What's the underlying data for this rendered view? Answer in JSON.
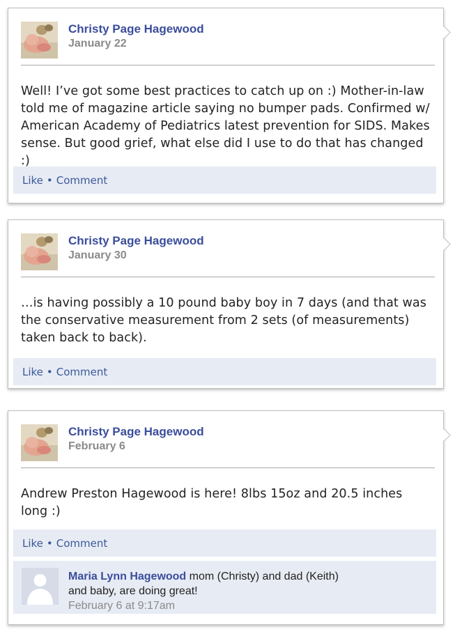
{
  "posts": [
    {
      "author": "Christy Page Hagewood",
      "date": "January 22",
      "text": "Well! I’ve got some best practices to catch up on :) Mother-in-law told me of magazine article saying no bumper pads. Confirmed w/ American Academy of Pediatrics latest prevention for SIDS. Makes sense. But good grief, what else did I use to do that has changed :)",
      "like": "Like",
      "comment": "Comment"
    },
    {
      "author": "Christy Page Hagewood",
      "date": "January 30",
      "text": "…is having possibly a 10 pound baby boy in 7 days (and that was the conservative measurement from 2 sets (of measurements) taken back to back).",
      "like": "Like",
      "comment": "Comment"
    },
    {
      "author": "Christy Page Hagewood",
      "date": "February 6",
      "text": "Andrew Preston Hagewood is here! 8lbs 15oz and 20.5 inches long :)",
      "like": "Like",
      "comment": "Comment",
      "reply": {
        "author": "Maria Lynn Hagewood",
        "text_line1": "mom (Christy) and dad (Keith)",
        "text_line2": "and baby, are doing great!",
        "time": "February 6 at 9:17am"
      }
    }
  ],
  "separator": "•",
  "icons": {
    "avatar": "baby-photo-avatar",
    "reply_avatar": "default-user-silhouette-icon"
  },
  "colors": {
    "link": "#3b5998",
    "name": "#3b4d9c",
    "action_bar": "#e7ebf4"
  }
}
